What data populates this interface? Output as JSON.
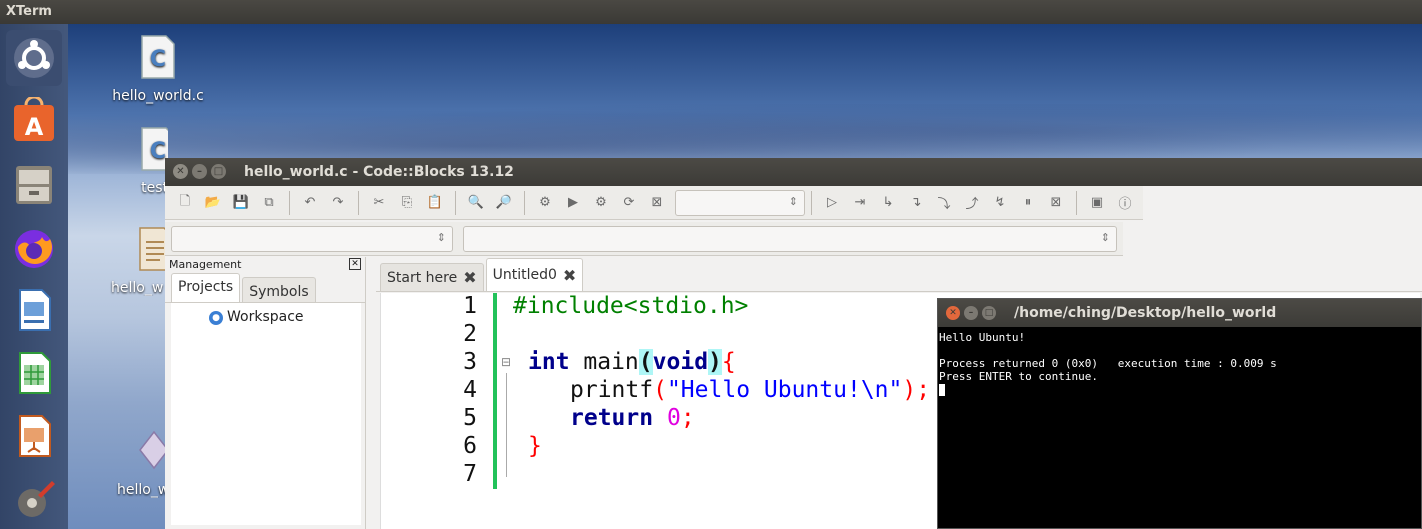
{
  "topbar": {
    "app_name": "XTerm"
  },
  "launcher": {
    "items": [
      "ubuntu-dash",
      "software-center",
      "files",
      "firefox",
      "writer",
      "calc",
      "impress",
      "system-settings"
    ]
  },
  "desktop": {
    "icons": [
      {
        "label": "hello_world.c",
        "icon": "c-file-icon"
      },
      {
        "label": "test",
        "icon": "c-file-icon"
      },
      {
        "label": "hello_w",
        "icon": "text-file-icon"
      },
      {
        "label": "hello_w",
        "icon": "executable-icon"
      }
    ]
  },
  "codeblocks": {
    "title": "hello_world.c - Code::Blocks 13.12",
    "management": {
      "header": "Management",
      "tabs": [
        "Projects",
        "Symbols"
      ],
      "tree_root": "Workspace"
    },
    "editor": {
      "tabs": [
        {
          "label": "Start here",
          "active": false
        },
        {
          "label": "Untitled0",
          "active": true
        }
      ],
      "line_numbers": [
        "1",
        "2",
        "3",
        "4",
        "5",
        "6",
        "7"
      ],
      "code": {
        "l1": "#include<stdio.h>",
        "l3_kw": "int",
        "l3_name": " main",
        "l3_paren_open": "(",
        "l3_void": "void",
        "l3_paren_close": ")",
        "l3_brace": "{",
        "l4_fn": "printf",
        "l4_open": "(",
        "l4_str": "\"Hello Ubuntu!\\n\"",
        "l4_close": ");",
        "l5_kw": "return",
        "l5_num": "0",
        "l5_semi": ";",
        "l6_brace": "}"
      }
    }
  },
  "terminal": {
    "title": "/home/ching/Desktop/hello_world",
    "lines": [
      "Hello Ubuntu!",
      "",
      "Process returned 0 (0x0)   execution time : 0.009 s",
      "Press ENTER to continue."
    ]
  },
  "colors": {
    "code_keyword": "#00008b",
    "code_preprocessor": "#008000",
    "code_string": "#0000ff",
    "code_number": "#e000e0",
    "code_brace": "#ff0000",
    "change_bar": "#22c25a"
  }
}
